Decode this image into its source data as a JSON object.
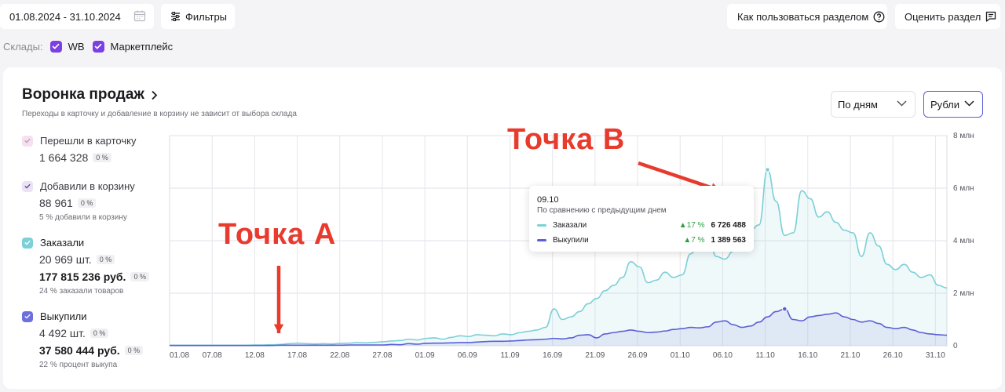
{
  "toolbar": {
    "date_range": "01.08.2024 - 31.10.2024",
    "filters_label": "Фильтры",
    "help_label": "Как пользоваться разделом",
    "rate_label": "Оценить раздел"
  },
  "warehouses": {
    "label": "Склады:",
    "items": [
      {
        "label": "WB",
        "checked": true
      },
      {
        "label": "Маркетплейс",
        "checked": true
      }
    ]
  },
  "panel": {
    "title": "Воронка продаж",
    "subtitle": "Переходы в карточку и добавление в корзину не зависит от выбора склада",
    "period_select": "По дням",
    "currency_select": "Рубли"
  },
  "metrics": [
    {
      "label": "Перешли в карточку",
      "value": "1 664 328",
      "pct": "0 %",
      "color": "#f5dff0"
    },
    {
      "label": "Добавили в корзину",
      "value": "88 961",
      "pct": "0 %",
      "note": "5 % добавили в корзину",
      "color": "#ebe3f5"
    },
    {
      "label": "Заказали",
      "value": "20 969 шт.",
      "pct": "0 %",
      "value2": "177 815 236 руб.",
      "pct2": "0 %",
      "note": "24 % заказали товаров",
      "color": "#7cd0d6"
    },
    {
      "label": "Выкупили",
      "value": "4 492 шт.",
      "pct": "0 %",
      "value2": "37 580 444 руб.",
      "pct2": "0 %",
      "note": "22 % процент выкупа",
      "color": "#6b6fe0"
    }
  ],
  "tooltip": {
    "date": "09.10",
    "compare": "По сравнению с предыдущим днем",
    "rows": [
      {
        "name": "Заказали",
        "change": "▲17 %",
        "value": "6 726 488",
        "color": "#7cd0d6"
      },
      {
        "name": "Выкупили",
        "change": "▲7 %",
        "value": "1 389 563",
        "color": "#5b5fd6"
      }
    ]
  },
  "annotations": {
    "point_a": "Точка А",
    "point_b": "Точка B"
  },
  "chart_data": {
    "type": "area",
    "x": [
      "01.08",
      "07.08",
      "12.08",
      "17.08",
      "22.08",
      "27.08",
      "01.09",
      "06.09",
      "11.09",
      "16.09",
      "21.09",
      "26.09",
      "01.10",
      "06.10",
      "11.10",
      "16.10",
      "21.10",
      "26.10",
      "31.10"
    ],
    "y_ticks": [
      "0",
      "2 млн",
      "4 млн",
      "6 млн",
      "8 млн"
    ],
    "ylim": [
      0,
      8000000
    ],
    "series": [
      {
        "name": "Заказали",
        "color": "#7cd0d6",
        "values": [
          20000,
          20000,
          20000,
          20000,
          20000,
          20000,
          20000,
          20000,
          20000,
          20000,
          30000,
          30000,
          40000,
          50000,
          80000,
          100000,
          80000,
          70000,
          80000,
          70000,
          90000,
          100000,
          120000,
          110000,
          130000,
          150000,
          180000,
          200000,
          250000,
          220000,
          280000,
          300000,
          250000,
          320000,
          380000,
          350000,
          420000,
          400000,
          380000,
          450000,
          420000,
          500000,
          550000,
          600000,
          700000,
          1400000,
          1000000,
          1100000,
          1300000,
          1600000,
          1800000,
          2100000,
          2300000,
          2600000,
          3200000,
          3000000,
          2400000,
          2500000,
          2800000,
          2600000,
          2700000,
          3500000,
          4000000,
          4400000,
          3400000,
          3300000,
          3600000,
          3800000,
          4400000,
          4600000,
          6700000,
          5500000,
          4200000,
          4300000,
          5900000,
          5600000,
          4900000,
          5100000,
          4700000,
          4400000,
          4300000,
          3400000,
          4300000,
          3800000,
          3100000,
          2900000,
          3100000,
          2800000,
          2600000,
          2700000,
          2300000,
          2200000
        ]
      },
      {
        "name": "Выкупили",
        "color": "#5b5fd6",
        "values": [
          10000,
          10000,
          10000,
          10000,
          10000,
          10000,
          10000,
          10000,
          10000,
          10000,
          10000,
          10000,
          10000,
          20000,
          20000,
          20000,
          20000,
          20000,
          20000,
          20000,
          20000,
          30000,
          30000,
          30000,
          30000,
          30000,
          50000,
          40000,
          80000,
          60000,
          90000,
          100000,
          100000,
          110000,
          120000,
          120000,
          140000,
          160000,
          170000,
          170000,
          180000,
          200000,
          220000,
          230000,
          250000,
          280000,
          260000,
          300000,
          400000,
          420000,
          300000,
          450000,
          500000,
          550000,
          600000,
          550000,
          500000,
          520000,
          560000,
          620000,
          650000,
          700000,
          680000,
          720000,
          900000,
          950000,
          800000,
          700000,
          750000,
          900000,
          1100000,
          1300000,
          1400000,
          1000000,
          950000,
          1100000,
          1150000,
          1200000,
          1250000,
          1100000,
          1000000,
          900000,
          950000,
          850000,
          700000,
          650000,
          700000,
          600000,
          500000,
          450000,
          420000,
          400000
        ]
      }
    ]
  }
}
